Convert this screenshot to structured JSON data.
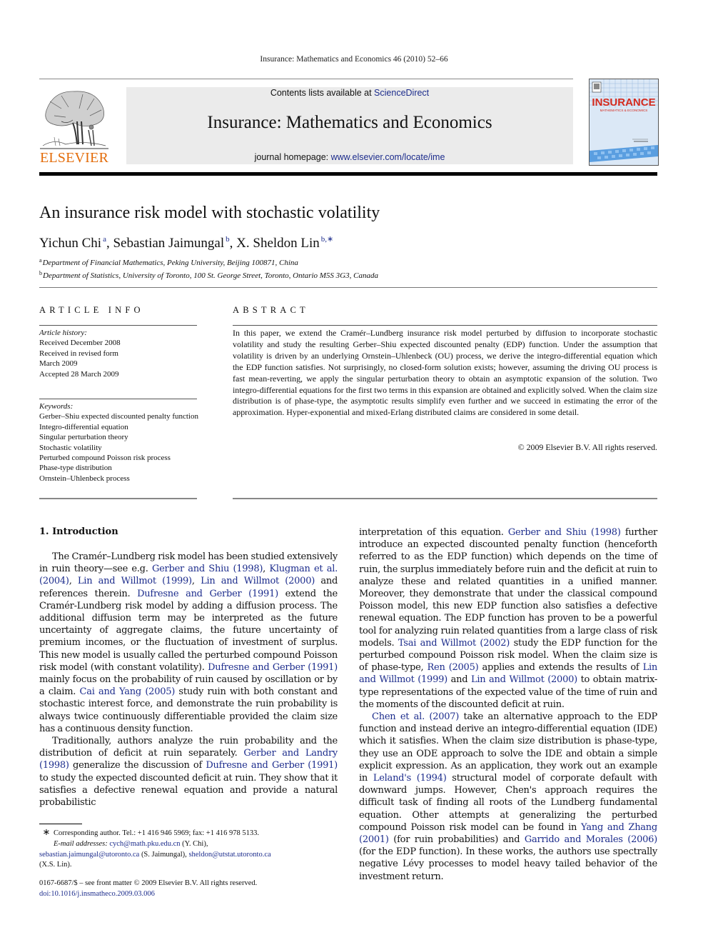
{
  "running_head": "Insurance: Mathematics and Economics 46 (2010) 52–66",
  "header": {
    "publisher": "ELSEVIER",
    "contents_prefix": "Contents lists available at ",
    "contents_link": "ScienceDirect",
    "journal_title": "Insurance: Mathematics and Economics",
    "homepage_prefix": "journal homepage: ",
    "homepage_link": "www.elsevier.com/locate/ime",
    "cover_title": "INSURANCE",
    "cover_subtitle": "MATHEMATICS & ECONOMICS"
  },
  "article": {
    "title": "An insurance risk model with stochastic volatility",
    "authors": [
      {
        "name": "Yichun Chi",
        "affil": "a"
      },
      {
        "name": "Sebastian Jaimungal",
        "affil": "b"
      },
      {
        "name": "X. Sheldon Lin",
        "affil": "b,∗"
      }
    ],
    "author_separator": ", ",
    "affiliations": [
      {
        "mark": "a",
        "text": "Department of Financial Mathematics, Peking University, Beijing 100871, China"
      },
      {
        "mark": "b",
        "text": "Department of Statistics, University of Toronto, 100 St. George Street, Toronto, Ontario M5S 3G3, Canada"
      }
    ]
  },
  "article_info": {
    "heading": "ARTICLE INFO",
    "history_label": "Article history:",
    "history": [
      "Received December 2008",
      "Received in revised form",
      "March 2009",
      "Accepted 28 March 2009"
    ],
    "keywords_label": "Keywords:",
    "keywords": [
      "Gerber–Shiu expected discounted penalty function",
      "Integro-differential equation",
      "Singular perturbation theory",
      "Stochastic volatility",
      "Perturbed compound Poisson risk process",
      "Phase-type distribution",
      "Ornstein–Uhlenbeck process"
    ]
  },
  "abstract": {
    "heading": "ABSTRACT",
    "text": "In this paper, we extend the Cramér–Lundberg insurance risk model perturbed by diffusion to incorporate stochastic volatility and study the resulting Gerber–Shiu expected discounted penalty (EDP) function. Under the assumption that volatility is driven by an underlying Ornstein–Uhlenbeck (OU) process, we derive the integro-differential equation which the EDP function satisfies. Not surprisingly, no closed-form solution exists; however, assuming the driving OU process is fast mean-reverting, we apply the singular perturbation theory to obtain an asymptotic expansion of the solution. Two integro-differential equations for the first two terms in this expansion are obtained and explicitly solved. When the claim size distribution is of phase-type, the asymptotic results simplify even further and we succeed in estimating the error of the approximation. Hyper-exponential and mixed-Erlang distributed claims are considered in some detail.",
    "copyright": "© 2009 Elsevier B.V. All rights reserved."
  },
  "body": {
    "section_heading": "1.  Introduction",
    "left_paragraphs": [
      [
        {
          "t": "The Cramér–Lundberg risk model has been studied extensively in ruin theory—see e.g. "
        },
        {
          "link": "Gerber and Shiu (1998)"
        },
        {
          "t": ", "
        },
        {
          "link": "Klugman et al. (2004)"
        },
        {
          "t": ", "
        },
        {
          "link": "Lin and Willmot (1999)"
        },
        {
          "t": ", "
        },
        {
          "link": "Lin and Willmot (2000)"
        },
        {
          "t": " and references therein. "
        },
        {
          "link": "Dufresne and Gerber (1991)"
        },
        {
          "t": " extend the Cramér-Lundberg risk model by adding a diffusion process. The additional diffusion term may be interpreted as the future uncertainty of aggregate claims, the future uncertainty of premium incomes, or the fluctuation of investment of surplus. This new model is usually called the perturbed compound Poisson risk model (with constant volatility). "
        },
        {
          "link": "Dufresne and Gerber (1991)"
        },
        {
          "t": " mainly focus on the probability of ruin caused by oscillation or by a claim. "
        },
        {
          "link": "Cai and Yang (2005)"
        },
        {
          "t": " study ruin with both constant and stochastic interest force, and demonstrate the ruin probability is always twice continuously differentiable provided the claim size has a continuous density function."
        }
      ],
      [
        {
          "t": "Traditionally, authors analyze the ruin probability and the distribution of deficit at ruin separately. "
        },
        {
          "link": "Gerber and Landry (1998)"
        },
        {
          "t": " generalize the discussion of "
        },
        {
          "link": "Dufresne and Gerber (1991)"
        },
        {
          "t": " to study the expected discounted deficit at ruin. They show that it satisfies a defective renewal equation and provide a natural probabilistic"
        }
      ]
    ],
    "right_paragraphs": [
      [
        {
          "t": "interpretation of this equation. "
        },
        {
          "link": "Gerber and Shiu (1998)"
        },
        {
          "t": " further introduce an expected discounted penalty function (henceforth referred to as the EDP function) which depends on the time of ruin, the surplus immediately before ruin and the deficit at ruin to analyze these and related quantities in a unified manner. Moreover, they demonstrate that under the classical compound Poisson model, this new EDP function also satisfies a defective renewal equation. The EDP function has proven to be a powerful tool for analyzing ruin related quantities from a large class of risk models. "
        },
        {
          "link": "Tsai and Willmot (2002)"
        },
        {
          "t": " study the EDP function for the perturbed compound Poisson risk model. When the claim size is of phase-type, "
        },
        {
          "link": "Ren (2005)"
        },
        {
          "t": " applies and extends the results of "
        },
        {
          "link": "Lin and Willmot (1999)"
        },
        {
          "t": " and "
        },
        {
          "link": "Lin and Willmot (2000)"
        },
        {
          "t": " to obtain matrix-type representations of the expected value of the time of ruin and the moments of the discounted deficit at ruin."
        }
      ],
      [
        {
          "link": "Chen et al. (2007)"
        },
        {
          "t": " take an alternative approach to the EDP function and instead derive an integro-differential equation (IDE) which it satisfies. When the claim size distribution is phase-type, they use an ODE approach to solve the IDE and obtain a simple explicit expression. As an application, they work out an example in "
        },
        {
          "link": "Leland's (1994)"
        },
        {
          "t": " structural model of corporate default with downward jumps. However, Chen's approach requires the difficult task of finding all roots of the Lundberg fundamental equation. Other attempts at generalizing the perturbed compound Poisson risk model can be found in "
        },
        {
          "link": "Yang and Zhang (2001)"
        },
        {
          "t": " (for ruin probabilities) and "
        },
        {
          "link": "Garrido and Morales (2006)"
        },
        {
          "t": " (for the EDP function). In these works, the authors use spectrally negative Lévy processes to model heavy tailed behavior of the investment return."
        }
      ]
    ]
  },
  "footnotes": {
    "star": "∗",
    "corresponding": "Corresponding author. Tel.: +1 416 946 5969; fax: +1 416 978 5133.",
    "email_label": "E-mail addresses:",
    "emails": [
      {
        "address": "cych@math.pku.edu.cn",
        "who": "(Y. Chi),"
      },
      {
        "address": "sebastian.jaimungal@utoronto.ca",
        "who": "(S. Jaimungal),"
      },
      {
        "address": "sheldon@utstat.utoronto.ca",
        "who": "(X.S. Lin)."
      }
    ],
    "front_matter": "0167-6687/$ – see front matter © 2009 Elsevier B.V. All rights reserved.",
    "doi": "doi:10.1016/j.insmatheco.2009.03.006"
  },
  "colors": {
    "link": "#1c2c8c",
    "elsevier_orange": "#e36c0a",
    "header_box": "#ebebeb",
    "cover_title_red": "#d42a1e"
  }
}
